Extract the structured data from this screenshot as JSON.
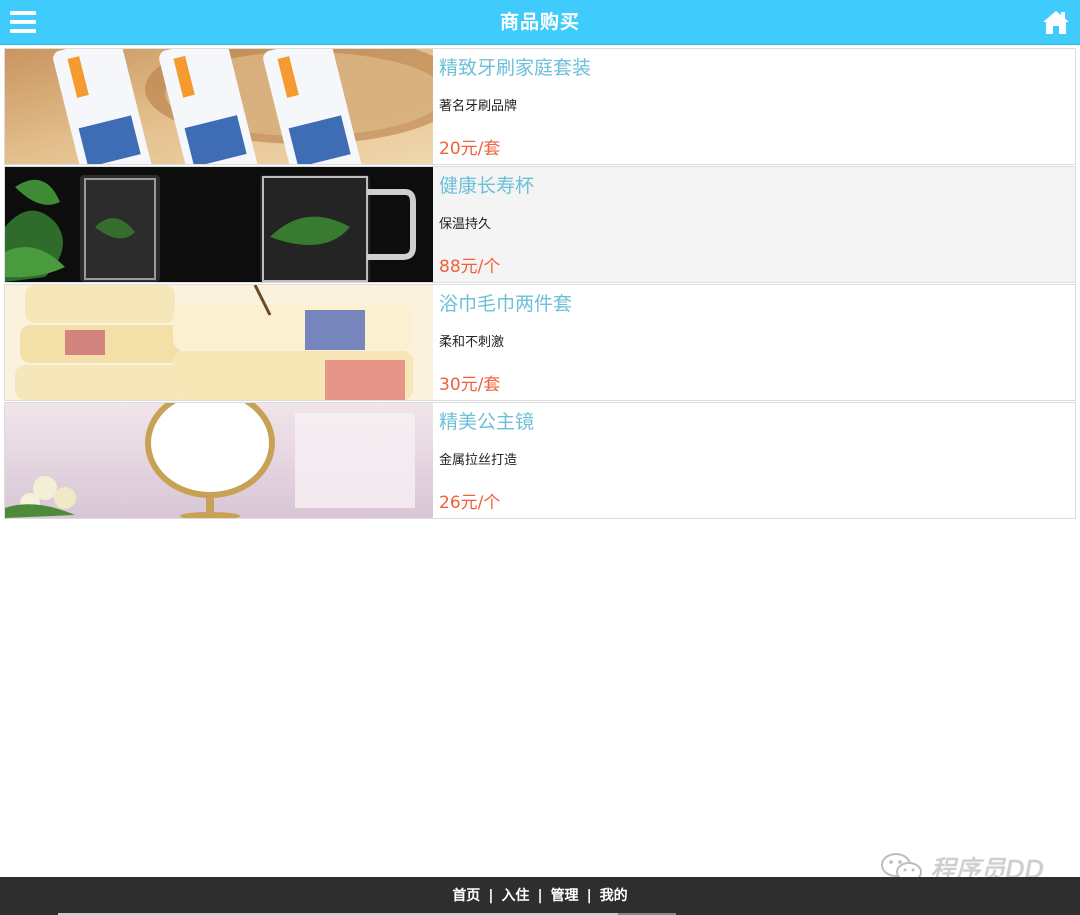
{
  "header": {
    "title": "商品购买",
    "menu_icon": "hamburger-menu-icon",
    "home_icon": "home-icon",
    "background_color": "#3fcbfb"
  },
  "products": [
    {
      "name": "精致牙刷家庭套装",
      "desc": "著名牙刷品牌",
      "price": "20元/套",
      "image": "toothbrush-set-image"
    },
    {
      "name": "健康长寿杯",
      "desc": "保温持久",
      "price": "88元/个",
      "image": "glass-cup-image"
    },
    {
      "name": "浴巾毛巾两件套",
      "desc": "柔和不刺激",
      "price": "30元/套",
      "image": "towel-set-image"
    },
    {
      "name": "精美公主镜",
      "desc": "金属拉丝打造",
      "price": "26元/个",
      "image": "princess-mirror-image"
    }
  ],
  "footer": {
    "links": [
      "首页",
      "入住",
      "管理",
      "我的"
    ],
    "separator": "|",
    "background_color": "#2e2e2e"
  },
  "watermark": {
    "text": "程序员DD",
    "icon": "wechat-icon"
  },
  "colors": {
    "name": "#6cc0d8",
    "price": "#f0603a"
  }
}
